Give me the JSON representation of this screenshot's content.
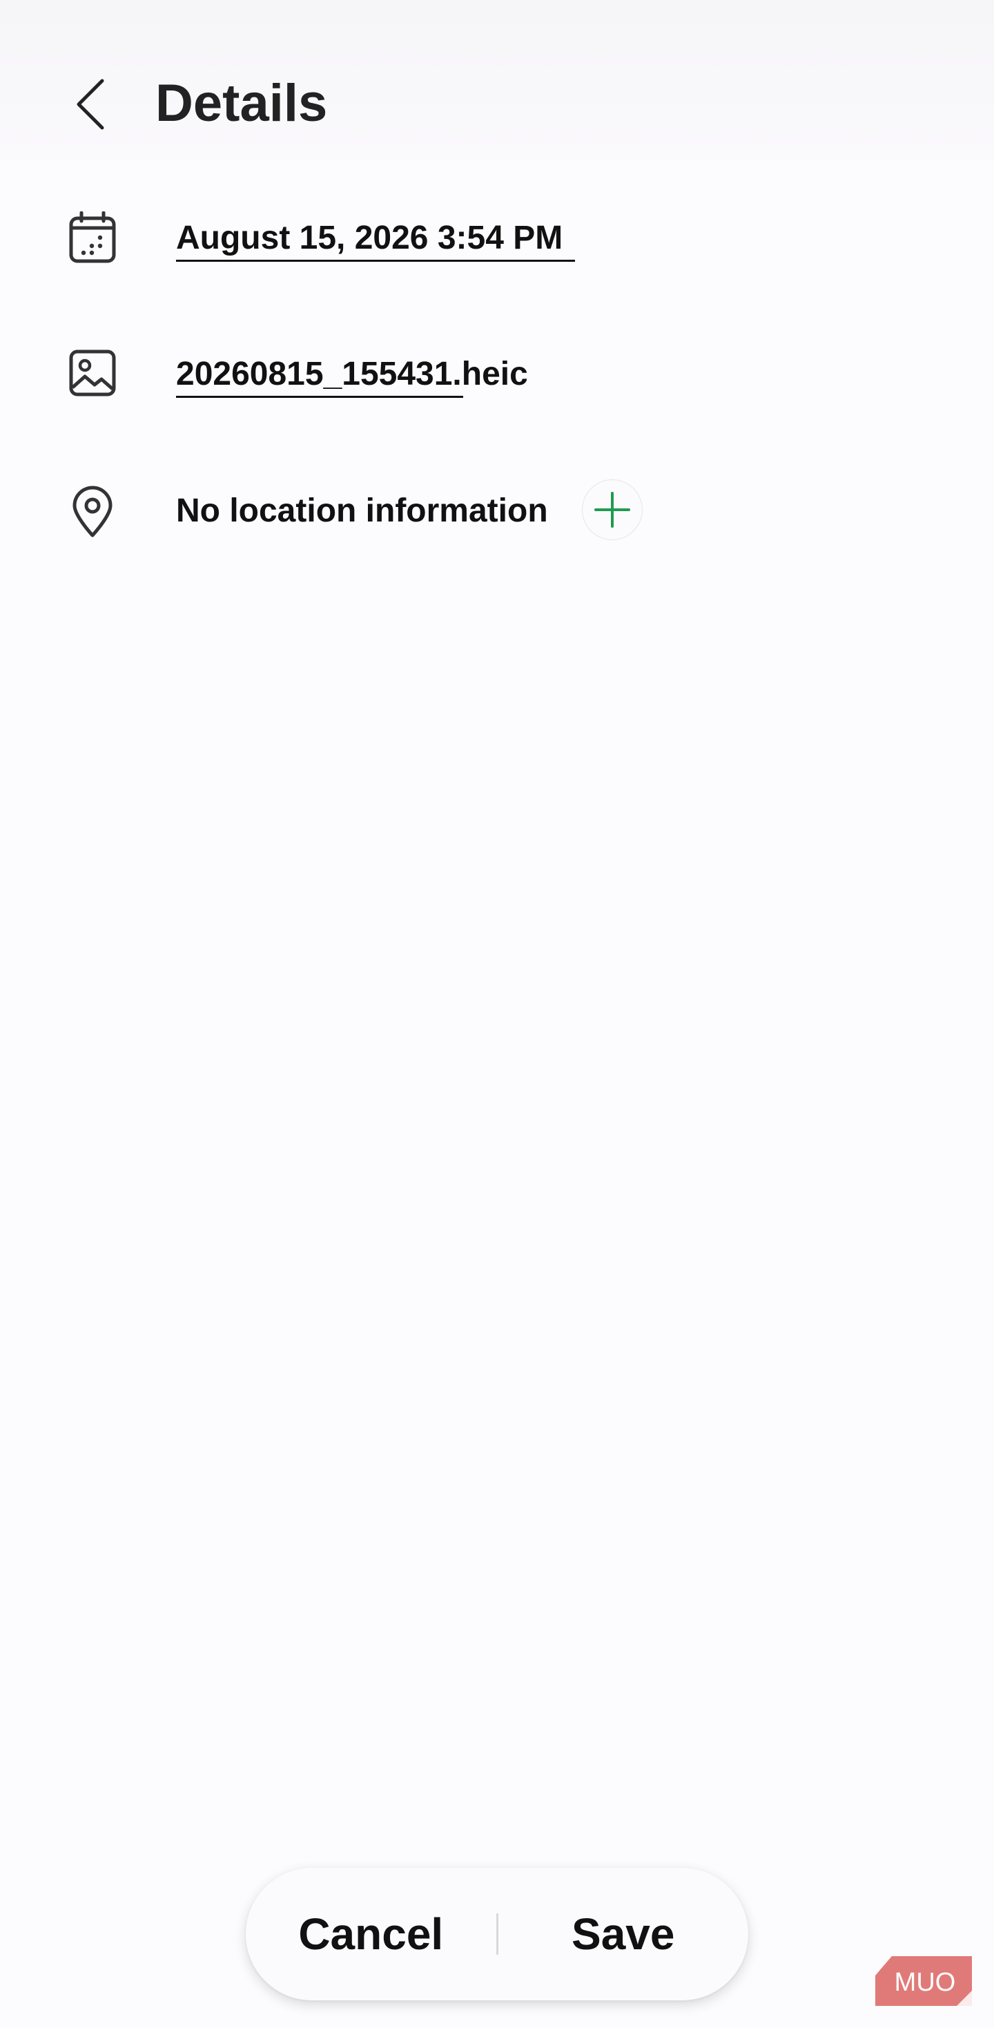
{
  "header": {
    "title": "Details",
    "back_icon": "chevron-left-icon"
  },
  "details": {
    "date_time": "August 15, 2026 3:54 PM",
    "date_icon": "calendar-icon",
    "filename": "20260815_155431.heic",
    "file_icon": "image-icon",
    "location": "No location information",
    "location_icon": "location-pin-icon",
    "add_location_icon": "plus-icon"
  },
  "footer": {
    "cancel_label": "Cancel",
    "save_label": "Save"
  },
  "logo": {
    "text": "MUO"
  },
  "colors": {
    "accent_green": "#1f9a50",
    "background": "#fcfbfe",
    "text": "#111111",
    "logo_red": "#e07a78"
  }
}
